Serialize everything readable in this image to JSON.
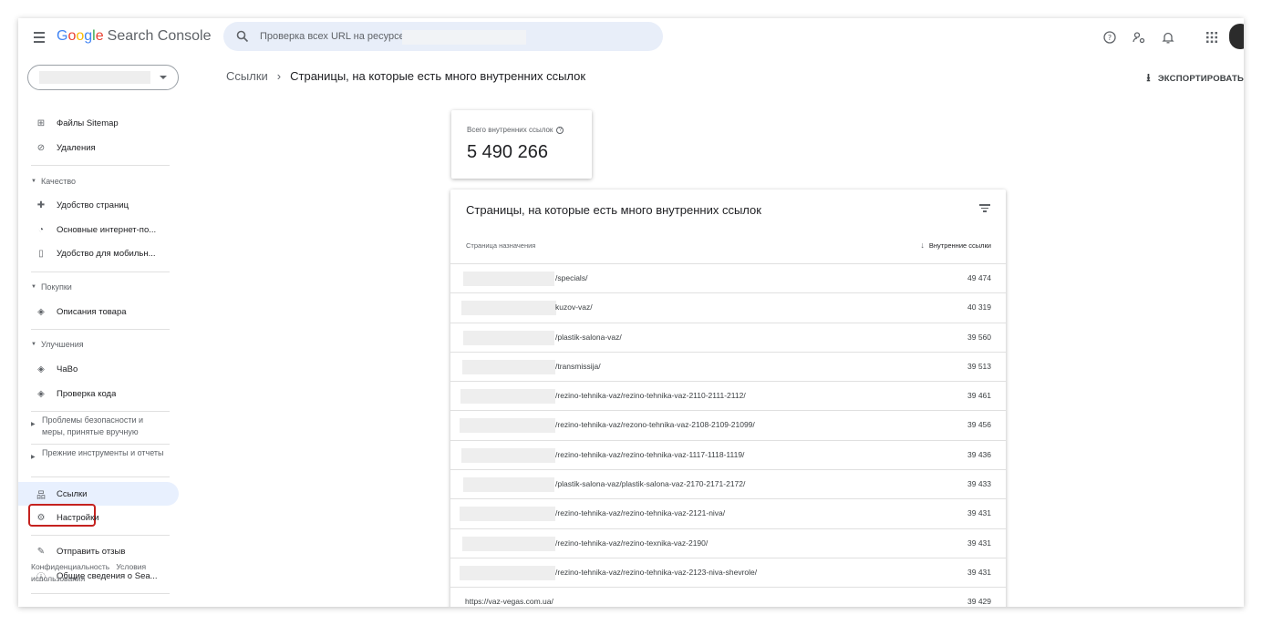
{
  "header": {
    "logo_google": [
      "G",
      "o",
      "o",
      "g",
      "l",
      "e"
    ],
    "logo_product": "Search Console",
    "search_placeholder": "Проверка всех URL на ресурсе"
  },
  "icons": [
    "menu-icon",
    "search-icon",
    "help-icon",
    "account-settings-icon",
    "notifications-icon",
    "apps-grid-icon",
    "avatar",
    "dropdown-caret-icon",
    "sitemap-icon",
    "removals-icon",
    "page-experience-icon",
    "core-web-vitals-icon",
    "mobile-icon",
    "product-icon",
    "faq-icon",
    "code-icon",
    "links-icon",
    "settings-icon",
    "feedback-icon",
    "info-icon",
    "download-icon",
    "filter-icon",
    "sort-arrow-icon"
  ],
  "sidebar": {
    "items_top": [
      {
        "label": "Файлы Sitemap",
        "icon": "⊞"
      },
      {
        "label": "Удаления",
        "icon": "⊘"
      }
    ],
    "section_quality": "Качество",
    "items_quality": [
      {
        "label": "Удобство страниц",
        "icon": "✚"
      },
      {
        "label": "Основные интернет-по...",
        "icon": "◔"
      },
      {
        "label": "Удобство для мобильн...",
        "icon": "▯"
      }
    ],
    "section_shopping": "Покупки",
    "items_shopping": [
      {
        "label": "Описания товара",
        "icon": "◈"
      }
    ],
    "section_improvements": "Улучшения",
    "items_improvements": [
      {
        "label": "ЧаВо",
        "icon": "◈"
      },
      {
        "label": "Проверка кода",
        "icon": "◈"
      }
    ],
    "section_security": "Проблемы безопасности и меры, принятые вручную",
    "section_legacy": "Прежние инструменты и отчеты",
    "item_links": {
      "label": "Ссылки",
      "icon": "品"
    },
    "item_settings": {
      "label": "Настройки",
      "icon": "⚙"
    },
    "item_feedback": {
      "label": "Отправить отзыв",
      "icon": "✎"
    },
    "item_about": {
      "label": "Общие сведения о Sea...",
      "icon": "ⓘ"
    },
    "footer_privacy": "Конфиденциальность",
    "footer_terms": "Условия использования"
  },
  "main": {
    "breadcrumb_parent": "Ссылки",
    "breadcrumb_separator": "›",
    "breadcrumb_current": "Страницы, на которые есть много внутренних ссылок",
    "export_label": "ЭКСПОРТИРОВАТЬ",
    "export_icon": "⭳",
    "total_label": "Всего внутренних ссылок",
    "total_help_icon": "?",
    "total_value": "5 490 266",
    "table_title": "Страницы, на которые есть много внутренних ссылок",
    "col_target": "Страница назначения",
    "col_links": "Внутренние ссылки",
    "sort_arrow": "↓",
    "rows": [
      {
        "path": "/specials/",
        "value": "49 474"
      },
      {
        "path": "kuzov-vaz/",
        "value": "40 319"
      },
      {
        "path": "/plastik-salona-vaz/",
        "value": "39 560"
      },
      {
        "path": "/transmissija/",
        "value": "39 513"
      },
      {
        "path": "/rezino-tehnika-vaz/rezino-tehnika-vaz-2110-2111-2112/",
        "value": "39 461"
      },
      {
        "path": "/rezino-tehnika-vaz/rezono-tehnika-vaz-2108-2109-21099/",
        "value": "39 456"
      },
      {
        "path": "/rezino-tehnika-vaz/rezino-tehnika-vaz-1117-1118-1119/",
        "value": "39 436"
      },
      {
        "path": "/plastik-salona-vaz/plastik-salona-vaz-2170-2171-2172/",
        "value": "39 433"
      },
      {
        "path": "/rezino-tehnika-vaz/rezino-tehnika-vaz-2121-niva/",
        "value": "39 431"
      },
      {
        "path": "/rezino-tehnika-vaz/rezino-texnika-vaz-2190/",
        "value": "39 431"
      },
      {
        "path": "/rezino-tehnika-vaz/rezino-tehnika-vaz-2123-niva-shevrole/",
        "value": "39 431"
      },
      {
        "path": "https://vaz-vegas.com.ua/",
        "value": "39 429"
      }
    ]
  }
}
